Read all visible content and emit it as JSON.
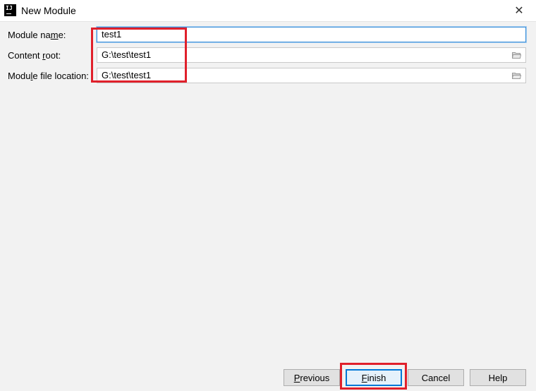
{
  "window": {
    "title": "New Module",
    "close_glyph": "✕"
  },
  "app_icon": {
    "glyph": "IJ"
  },
  "form": {
    "module_name": {
      "label_pre": "Module na",
      "label_mnemonic": "m",
      "label_post": "e:",
      "value": "test1"
    },
    "content_root": {
      "label_pre": "Content ",
      "label_mnemonic": "r",
      "label_post": "oot:",
      "value": "G:\\test\\test1"
    },
    "module_file_location": {
      "label_pre": "Modu",
      "label_mnemonic": "l",
      "label_post": "e file location:",
      "value": "G:\\test\\test1"
    }
  },
  "buttons": {
    "previous": {
      "mnemonic": "P",
      "rest": "revious"
    },
    "finish": {
      "mnemonic": "F",
      "rest": "inish"
    },
    "cancel": {
      "label": "Cancel"
    },
    "help": {
      "label": "Help"
    }
  },
  "colors": {
    "highlight": "#e0202b",
    "focus": "#3b8fd9",
    "background": "#f2f2f2"
  }
}
